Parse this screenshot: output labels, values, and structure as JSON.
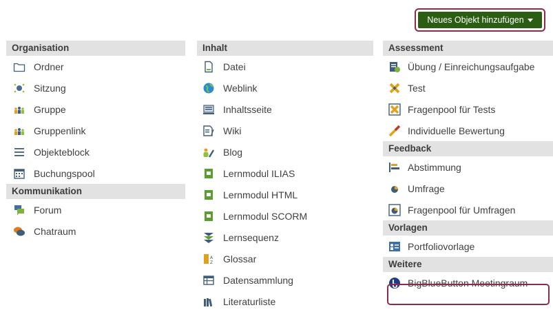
{
  "toolbar": {
    "add_object_label": "Neues Objekt hinzufügen"
  },
  "columns": {
    "organisation": {
      "header": "Organisation",
      "items": [
        "Ordner",
        "Sitzung",
        "Gruppe",
        "Gruppenlink",
        "Objekteblock",
        "Buchungspool"
      ]
    },
    "kommunikation": {
      "header": "Kommunikation",
      "items": [
        "Forum",
        "Chatraum"
      ]
    },
    "inhalt": {
      "header": "Inhalt",
      "items": [
        "Datei",
        "Weblink",
        "Inhaltsseite",
        "Wiki",
        "Blog",
        "Lernmodul ILIAS",
        "Lernmodul HTML",
        "Lernmodul SCORM",
        "Lernsequenz",
        "Glossar",
        "Datensammlung",
        "Literaturliste"
      ]
    },
    "assessment": {
      "header": "Assessment",
      "items": [
        "Übung / Einreichungsaufgabe",
        "Test",
        "Fragenpool für Tests",
        "Individuelle Bewertung"
      ]
    },
    "feedback": {
      "header": "Feedback",
      "items": [
        "Abstimmung",
        "Umfrage",
        "Fragenpool für Umfragen"
      ]
    },
    "vorlagen": {
      "header": "Vorlagen",
      "items": [
        "Portfoliovorlage"
      ]
    },
    "weitere": {
      "header": "Weitere",
      "items": [
        "BigBlueButton Meetingraum"
      ]
    }
  },
  "colors": {
    "button_bg": "#2b5e13",
    "highlight_border": "#8b2a4a",
    "header_bg": "#e2e2e2"
  }
}
